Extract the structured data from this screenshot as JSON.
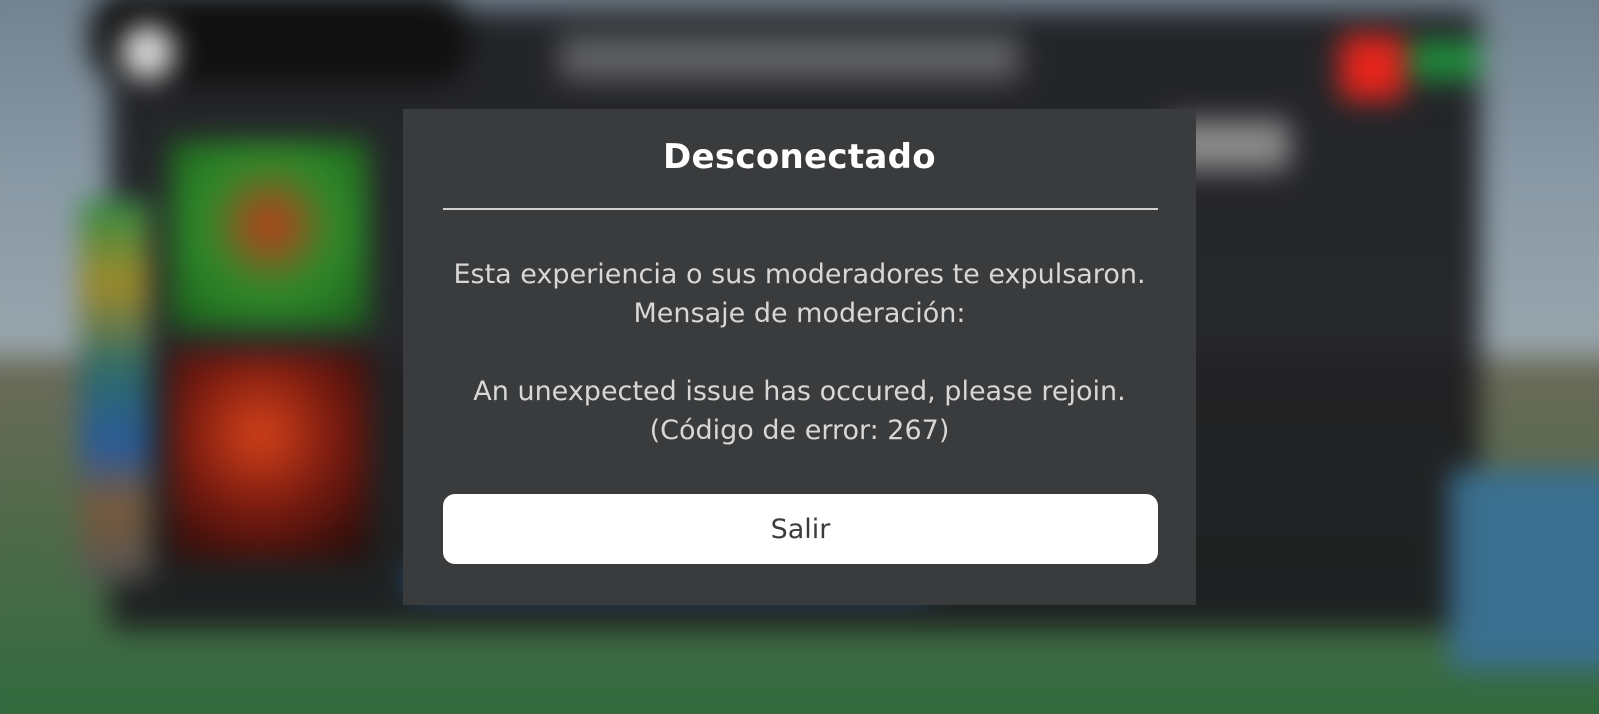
{
  "dialog": {
    "title": "Desconectado",
    "message_lines": [
      "Esta experiencia o sus moderadores te expulsaron.",
      "Mensaje de moderación:",
      "An unexpected issue has occured, please rejoin.",
      "(Código de error: 267)"
    ],
    "exit_label": "Salir"
  },
  "colors": {
    "dialog_background": "#393b3d",
    "title_text": "#ffffff",
    "body_text": "#d7d7d7",
    "divider": "#cfcfcf",
    "button_background": "#ffffff",
    "button_text": "#393b3d"
  }
}
